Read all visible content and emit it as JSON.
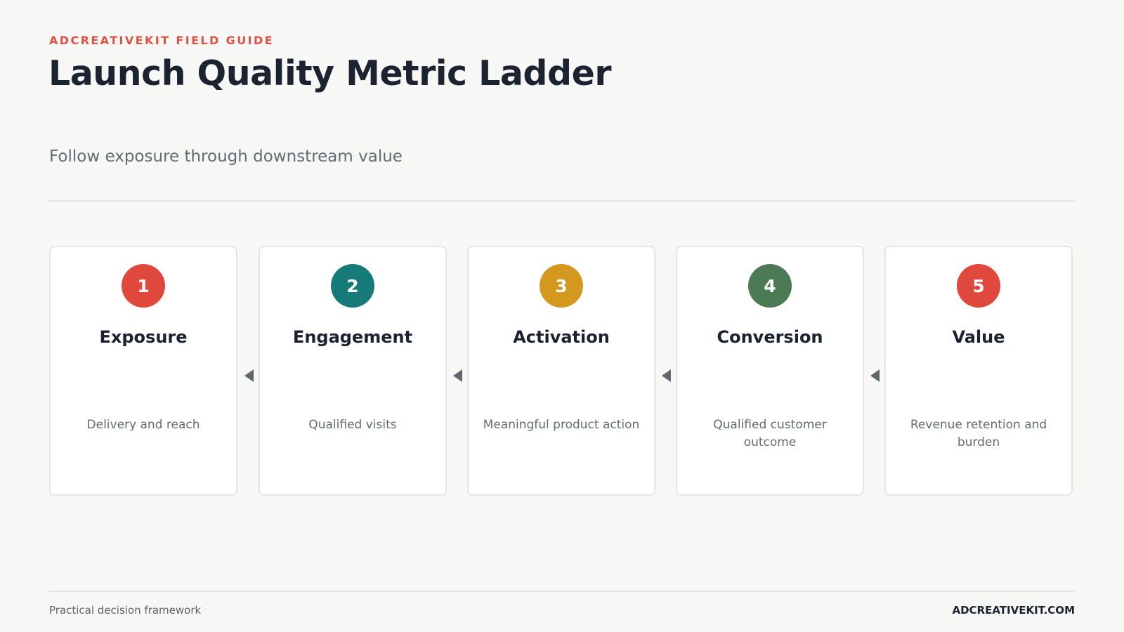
{
  "header": {
    "eyebrow": "ADCREATIVEKIT FIELD GUIDE",
    "title": "Launch Quality Metric Ladder",
    "subtitle": "Follow exposure through downstream value"
  },
  "steps": [
    {
      "number": "1",
      "title": "Exposure",
      "description": "Delivery and reach",
      "color": "#e0483d"
    },
    {
      "number": "2",
      "title": "Engagement",
      "description": "Qualified visits",
      "color": "#167a78"
    },
    {
      "number": "3",
      "title": "Activation",
      "description": "Meaningful product action",
      "color": "#d3981d"
    },
    {
      "number": "4",
      "title": "Conversion",
      "description": "Qualified customer outcome",
      "color": "#4c7a55"
    },
    {
      "number": "5",
      "title": "Value",
      "description": "Revenue retention and burden",
      "color": "#e0483d"
    }
  ],
  "connector": {
    "icon": "arrow-left-icon",
    "color": "#5f676f"
  },
  "footer": {
    "left": "Practical decision framework",
    "right": "ADCREATIVEKIT.COM"
  }
}
